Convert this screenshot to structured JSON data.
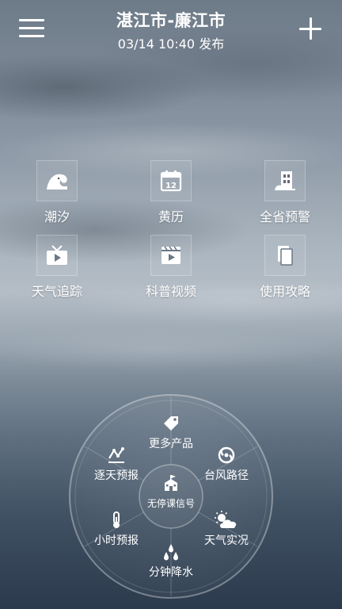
{
  "header": {
    "title": "湛江市-廉江市",
    "subtitle": "03/14  10:40 发布"
  },
  "features": {
    "tide": "潮汐",
    "almanac": "黄历",
    "almanac_day": "12",
    "province_warning": "全省预警",
    "weather_tracking": "天气追踪",
    "science_video": "科普视频",
    "user_guide": "使用攻略"
  },
  "wheel": {
    "more_products": "更多产品",
    "daily_forecast": "逐天预报",
    "typhoon_path": "台风路径",
    "hourly_forecast": "小时预报",
    "live_weather": "天气实况",
    "minute_precipitation": "分钟降水",
    "school_closure": "无停课信号"
  },
  "icons": {
    "menu": "hamburger-icon",
    "add": "plus-icon",
    "tide": "wave-icon",
    "almanac": "calendar-icon",
    "province_warning": "building-icon",
    "weather_tracking": "tv-icon",
    "science_video": "video-icon",
    "user_guide": "book-icon",
    "more_products": "tag-icon",
    "daily_forecast": "trend-icon",
    "typhoon_path": "typhoon-icon",
    "hourly_forecast": "thermometer-icon",
    "live_weather": "sun-cloud-icon",
    "minute_precipitation": "raindrops-icon",
    "school_closure": "school-icon"
  }
}
